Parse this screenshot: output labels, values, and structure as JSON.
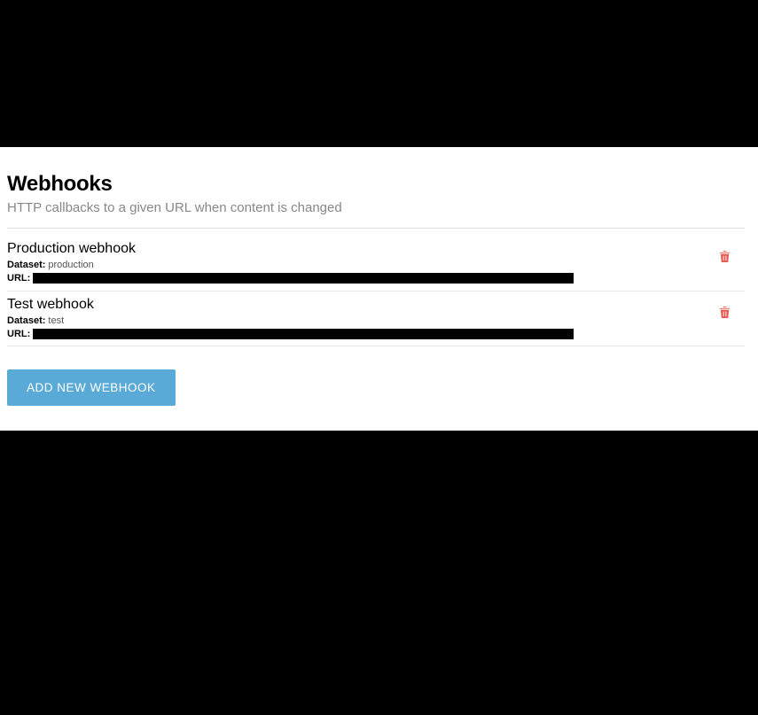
{
  "header": {
    "title": "Webhooks",
    "subtitle": "HTTP callbacks to a given URL when content is changed"
  },
  "labels": {
    "dataset": "Dataset:",
    "url": "URL:"
  },
  "webhooks": [
    {
      "name": "Production webhook",
      "dataset": "production"
    },
    {
      "name": "Test webhook",
      "dataset": "test"
    }
  ],
  "actions": {
    "add_button": "ADD NEW WEBHOOK"
  }
}
